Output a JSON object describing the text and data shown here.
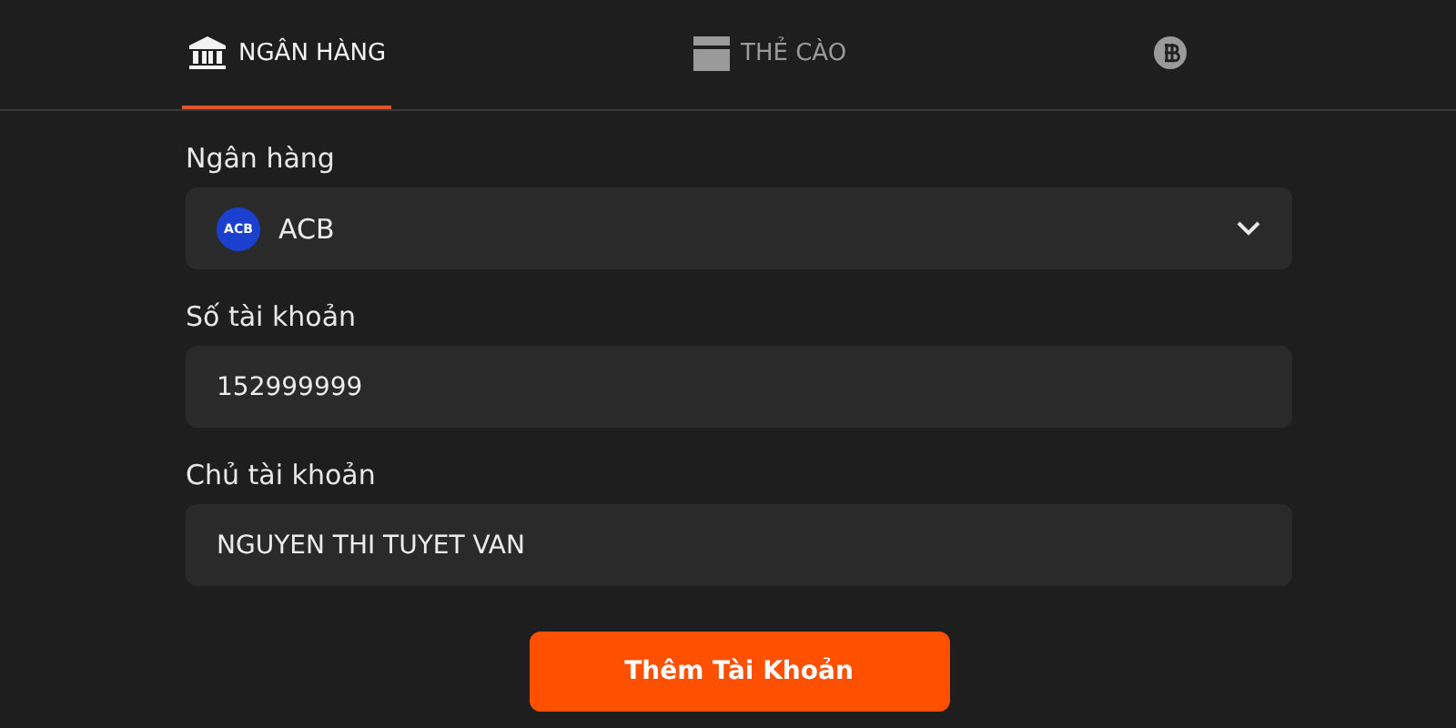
{
  "tabs": [
    {
      "kind": "bank",
      "label": "NGÂN HÀNG",
      "selected": true
    },
    {
      "kind": "card",
      "label": "THẺ CÀO",
      "selected": false
    },
    {
      "kind": "coin",
      "selected": false
    }
  ],
  "form": {
    "bank": {
      "label": "Ngân hàng",
      "logo_text": "ACB",
      "value": "ACB"
    },
    "fields": [
      {
        "label": "Số tài khoản",
        "value": "152999999"
      },
      {
        "label": "Chủ tài khoản",
        "value": "NGUYEN THI TUYET VAN"
      }
    ],
    "submit": "Thêm Tài Khoản"
  }
}
